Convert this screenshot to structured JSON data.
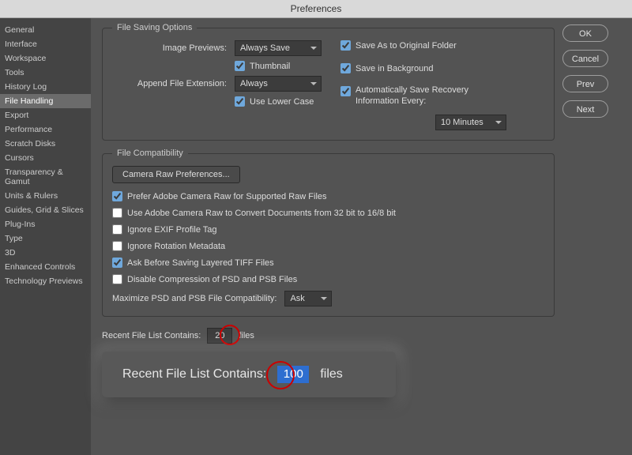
{
  "window": {
    "title": "Preferences"
  },
  "sidebar": {
    "items": [
      "General",
      "Interface",
      "Workspace",
      "Tools",
      "History Log",
      "File Handling",
      "Export",
      "Performance",
      "Scratch Disks",
      "Cursors",
      "Transparency & Gamut",
      "Units & Rulers",
      "Guides, Grid & Slices",
      "Plug-Ins",
      "Type",
      "3D",
      "Enhanced Controls",
      "Technology Previews"
    ],
    "active_index": 5
  },
  "saving": {
    "legend": "File Saving Options",
    "image_previews_label": "Image Previews:",
    "image_previews_value": "Always Save",
    "thumbnail_label": "Thumbnail",
    "thumbnail_checked": true,
    "append_ext_label": "Append File Extension:",
    "append_ext_value": "Always",
    "lowercase_label": "Use Lower Case",
    "lowercase_checked": true,
    "save_original_label": "Save As to Original Folder",
    "save_original_checked": true,
    "save_bg_label": "Save in Background",
    "save_bg_checked": true,
    "auto_recover_label": "Automatically Save Recovery Information Every:",
    "auto_recover_checked": true,
    "auto_recover_interval": "10 Minutes"
  },
  "compat": {
    "legend": "File Compatibility",
    "camera_raw_btn": "Camera Raw Preferences...",
    "options": [
      {
        "label": "Prefer Adobe Camera Raw for Supported Raw Files",
        "checked": true
      },
      {
        "label": "Use Adobe Camera Raw to Convert Documents from 32 bit to 16/8 bit",
        "checked": false
      },
      {
        "label": "Ignore EXIF Profile Tag",
        "checked": false
      },
      {
        "label": "Ignore Rotation Metadata",
        "checked": false
      },
      {
        "label": "Ask Before Saving Layered TIFF Files",
        "checked": true
      },
      {
        "label": "Disable Compression of PSD and PSB Files",
        "checked": false
      }
    ],
    "maximize_label": "Maximize PSD and PSB File Compatibility:",
    "maximize_value": "Ask"
  },
  "recent": {
    "label": "Recent File List Contains:",
    "value": "20",
    "suffix": "files",
    "callout_value": "100"
  },
  "buttons": {
    "ok": "OK",
    "cancel": "Cancel",
    "prev": "Prev",
    "next": "Next"
  }
}
